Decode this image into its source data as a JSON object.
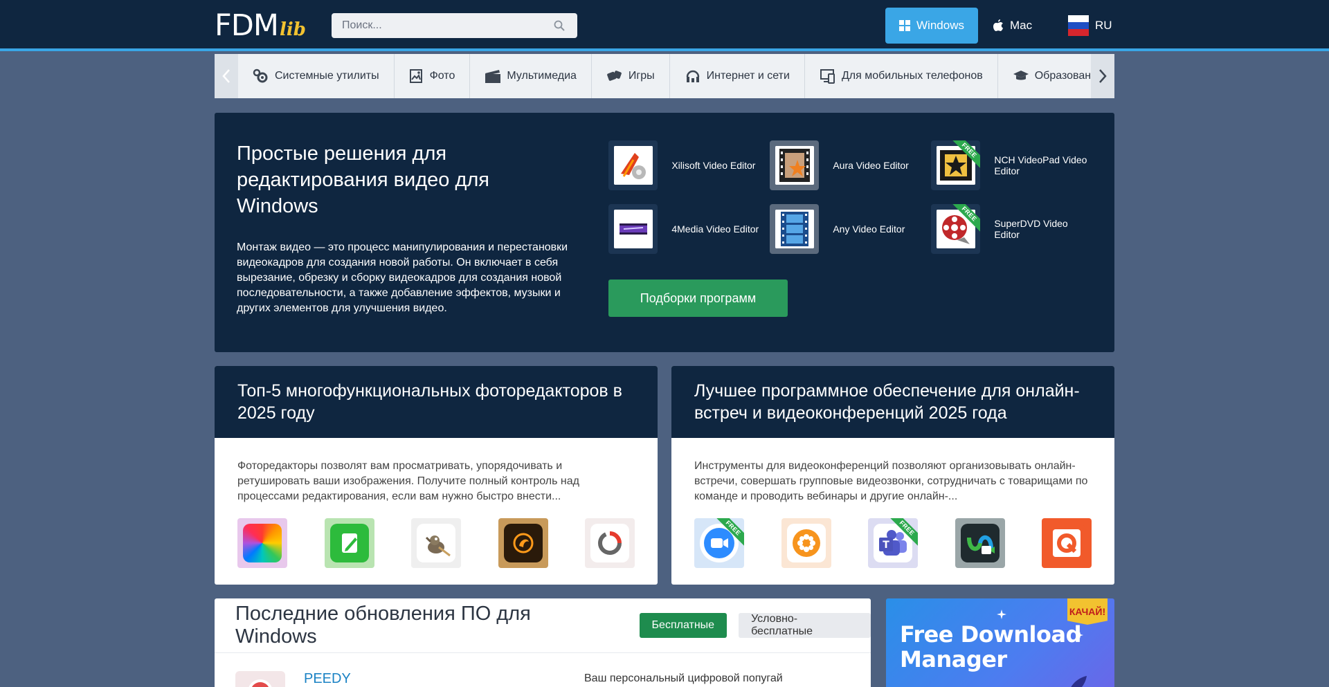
{
  "header": {
    "logo_main": "FDM",
    "logo_sub": "lib",
    "search_placeholder": "Поиск...",
    "os_windows": "Windows",
    "os_mac": "Mac",
    "lang": "RU"
  },
  "categories": [
    {
      "label": "Системные утилиты",
      "icon": "gears-icon"
    },
    {
      "label": "Фото",
      "icon": "photo-icon"
    },
    {
      "label": "Мультимедиа",
      "icon": "clapperboard-icon"
    },
    {
      "label": "Игры",
      "icon": "dice-icon"
    },
    {
      "label": "Интернет и сети",
      "icon": "network-icon"
    },
    {
      "label": "Для мобильных телефонов",
      "icon": "mobile-icon"
    },
    {
      "label": "Образование",
      "icon": "graduation-cap-icon"
    }
  ],
  "hero": {
    "title": "Простые решения для редактирования видео для Windows",
    "text": "Монтаж видео — это процесс манипулирования и перестановки видеокадров для создания новой работы. Он включает в себя вырезание, обрезку и сборку видеокадров для создания новой последовательности, а также добавление эффектов, музыки и других элементов для улучшения видео.",
    "apps": [
      {
        "name": "Xilisoft Video Editor",
        "free": false
      },
      {
        "name": "Aura Video Editor",
        "free": false
      },
      {
        "name": "NCH VideoPad Video Editor",
        "free": true
      },
      {
        "name": "4Media Video Editor",
        "free": false
      },
      {
        "name": "Any Video Editor",
        "free": false
      },
      {
        "name": "SuperDVD Video Editor",
        "free": true
      }
    ],
    "free_label": "FREE",
    "button": "Подборки программ"
  },
  "cards": [
    {
      "title": "Топ-5 многофункциональных фоторедакторов в 2025 году",
      "text": "Фоторедакторы позволят вам просматривать, упорядочивать и ретушировать ваши изображения. Получите полный контроль над процессами редактирования, если вам нужно быстро внести..."
    },
    {
      "title": "Лучшее программное обеспечение для онлайн-встреч и видеоконференций 2025 года",
      "text": "Инструменты для видеоконференций позволяют организовывать онлайн-встречи, совершать групповые видеозвонки, сотрудничать с товарищами по команде и проводить вебинары и другие онлайн-..."
    }
  ],
  "updates": {
    "title": "Последние обновления ПО для Windows",
    "tab_free": "Бесплатные",
    "tab_shareware": "Условно-бесплатные",
    "first_item": {
      "name": "PEEDY",
      "description": "Ваш персональный цифровой попугай"
    }
  },
  "ad": {
    "title_line1": "Free Download",
    "title_line2": "Manager",
    "badge": "КАЧАЙ!"
  },
  "colors": {
    "header_bg": "#0f2640",
    "accent_blue": "#3aa6e6",
    "page_bg": "#4d6180",
    "green": "#2a9a5c",
    "logo_yellow": "#f2c230"
  }
}
